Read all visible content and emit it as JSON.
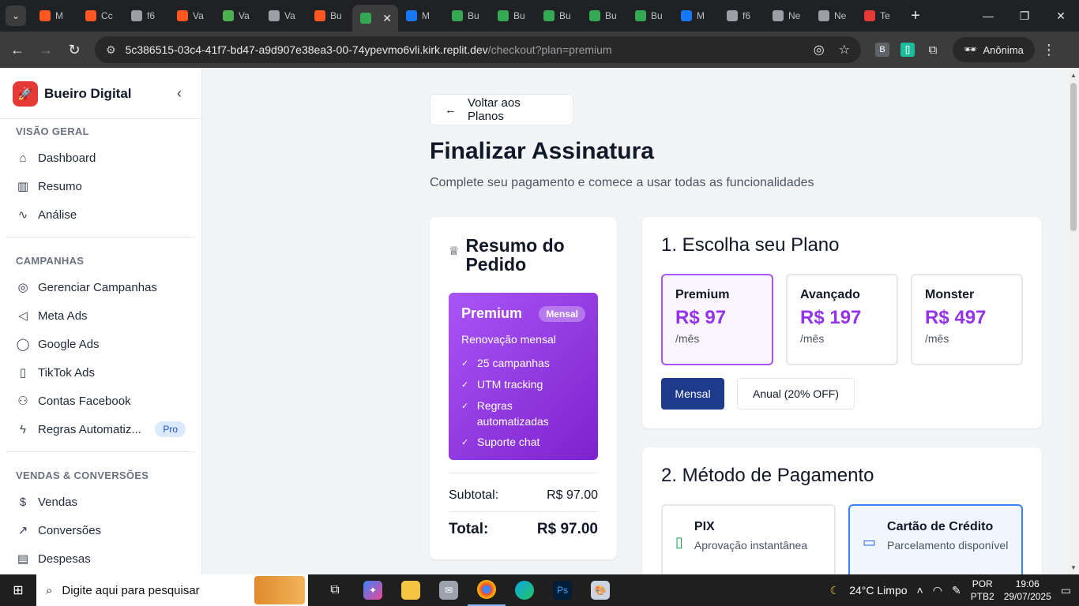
{
  "browser": {
    "tabs": [
      {
        "label": "M",
        "color": "#ff5722"
      },
      {
        "label": "Cc",
        "color": "#ff5722"
      },
      {
        "label": "f6",
        "color": "#9aa0a6"
      },
      {
        "label": "Va",
        "color": "#ff5722"
      },
      {
        "label": "Va",
        "color": "#4caf50"
      },
      {
        "label": "Va",
        "color": "#9aa0a6"
      },
      {
        "label": "Bu",
        "color": "#ff5722"
      },
      {
        "label": "",
        "color": "#34a853"
      },
      {
        "label": "M",
        "color": "#1877f2"
      },
      {
        "label": "Bu",
        "color": "#34a853"
      },
      {
        "label": "Bu",
        "color": "#34a853"
      },
      {
        "label": "Bu",
        "color": "#34a853"
      },
      {
        "label": "Bu",
        "color": "#34a853"
      },
      {
        "label": "Bu",
        "color": "#34a853"
      },
      {
        "label": "M",
        "color": "#1877f2"
      },
      {
        "label": "f6",
        "color": "#9aa0a6"
      },
      {
        "label": "Ne",
        "color": "#9aa0a6"
      },
      {
        "label": "Ne",
        "color": "#9aa0a6"
      },
      {
        "label": "Te",
        "color": "#e53935"
      }
    ],
    "url_host": "5c386515-03c4-41f7-bd47-a9d907e38ea3-00-74ypevmo6vli.kirk.replit.dev",
    "url_path": "/checkout?plan=premium",
    "profile_label": "Anônima"
  },
  "sidebar": {
    "brand": "Bueiro Digital",
    "sections": [
      {
        "title": "VISÃO GERAL",
        "items": [
          {
            "label": "Dashboard",
            "icon": "home-icon"
          },
          {
            "label": "Resumo",
            "icon": "bar-chart-icon"
          },
          {
            "label": "Análise",
            "icon": "activity-icon"
          }
        ]
      },
      {
        "title": "CAMPANHAS",
        "items": [
          {
            "label": "Gerenciar Campanhas",
            "icon": "target-icon"
          },
          {
            "label": "Meta Ads",
            "icon": "megaphone-icon"
          },
          {
            "label": "Google Ads",
            "icon": "globe-icon"
          },
          {
            "label": "TikTok Ads",
            "icon": "phone-icon"
          },
          {
            "label": "Contas Facebook",
            "icon": "users-icon"
          },
          {
            "label": "Regras Automatiz...",
            "icon": "zap-icon",
            "badge": "Pro"
          }
        ]
      },
      {
        "title": "VENDAS & CONVERSÕES",
        "items": [
          {
            "label": "Vendas",
            "icon": "dollar-icon"
          },
          {
            "label": "Conversões",
            "icon": "trending-icon"
          },
          {
            "label": "Despesas",
            "icon": "receipt-icon"
          }
        ]
      }
    ]
  },
  "main": {
    "back_label": "Voltar aos Planos",
    "title": "Finalizar Assinatura",
    "subtitle": "Complete seu pagamento e comece a usar todas as funcionalidades",
    "summary": {
      "title": "Resumo do Pedido",
      "plan_name": "Premium",
      "plan_badge": "Mensal",
      "renewal": "Renovação mensal",
      "features": [
        "25 campanhas",
        "UTM tracking",
        "Regras automatizadas",
        "Suporte chat"
      ],
      "subtotal_label": "Subtotal:",
      "subtotal_value": "R$ 97.00",
      "total_label": "Total:",
      "total_value": "R$ 97.00"
    },
    "plans_card": {
      "title": "1. Escolha seu Plano",
      "options": [
        {
          "name": "Premium",
          "price": "R$ 97",
          "period": "/mês",
          "selected": true
        },
        {
          "name": "Avançado",
          "price": "R$ 197",
          "period": "/mês",
          "selected": false
        },
        {
          "name": "Monster",
          "price": "R$ 497",
          "period": "/mês",
          "selected": false
        }
      ],
      "billing_monthly": "Mensal",
      "billing_annual": "Anual (20% OFF)"
    },
    "payment_card": {
      "title": "2. Método de Pagamento",
      "options": [
        {
          "name": "PIX",
          "desc": "Aprovação instantânea",
          "selected": false
        },
        {
          "name": "Cartão de Crédito",
          "desc": "Parcelamento disponível",
          "selected": true
        }
      ]
    }
  },
  "taskbar": {
    "search_placeholder": "Digite aqui para pesquisar",
    "weather": "24°C  Limpo",
    "lang_top": "POR",
    "lang_bottom": "PTB2",
    "time": "19:06",
    "date": "29/07/2025"
  },
  "colors": {
    "accent_purple": "#9333ea",
    "navy_button": "#1e3a8a",
    "brand_red": "#e53935"
  }
}
